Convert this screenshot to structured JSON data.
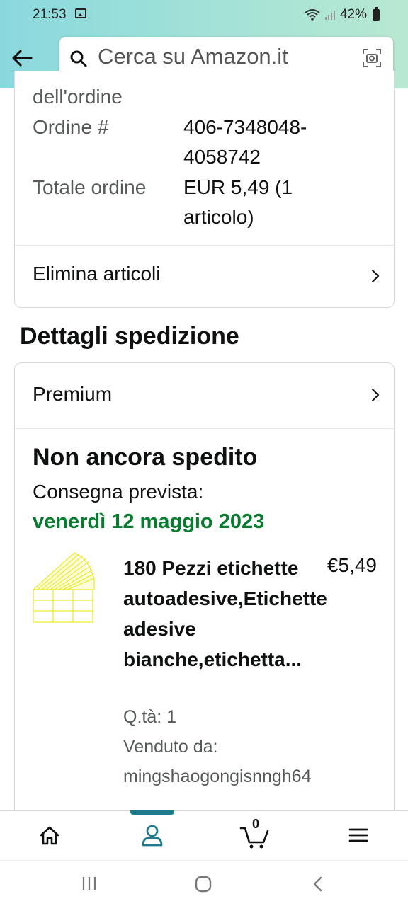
{
  "status_bar": {
    "time": "21:53",
    "battery": "42%"
  },
  "search": {
    "placeholder": "Cerca su Amazon.it"
  },
  "order": {
    "date_label_tail": "dell'ordine",
    "number_label": "Ordine #",
    "number_line1": "406-7348048-",
    "number_line2": "4058742",
    "total_label": "Totale ordine",
    "total_line1": "EUR 5,49 (1",
    "total_line2": "articolo)",
    "remove_items": "Elimina articoli"
  },
  "shipping": {
    "section_title": "Dettagli spedizione",
    "method": "Premium",
    "status": "Non ancora spedito",
    "delivery_label": "Consegna prevista:",
    "delivery_date": "venerdì 12 maggio 2023",
    "delivery_color": "#067d2e"
  },
  "product": {
    "title": "180 Pezzi etichette autoadesive,Etichette adesive bianche,etichetta...",
    "price": "€5,49",
    "qty": "Q.tà: 1",
    "seller_label": "Venduto da:",
    "seller": "mingshaogongisnngh64"
  },
  "bottom_nav": {
    "items": [
      "home-icon",
      "account-icon",
      "cart-icon",
      "menu-icon"
    ],
    "active": "account-icon",
    "cart_count": "0"
  },
  "colors": {
    "accent": "#1f7a8c",
    "header_start": "#8ad8de",
    "header_end": "#b8e8d2"
  }
}
